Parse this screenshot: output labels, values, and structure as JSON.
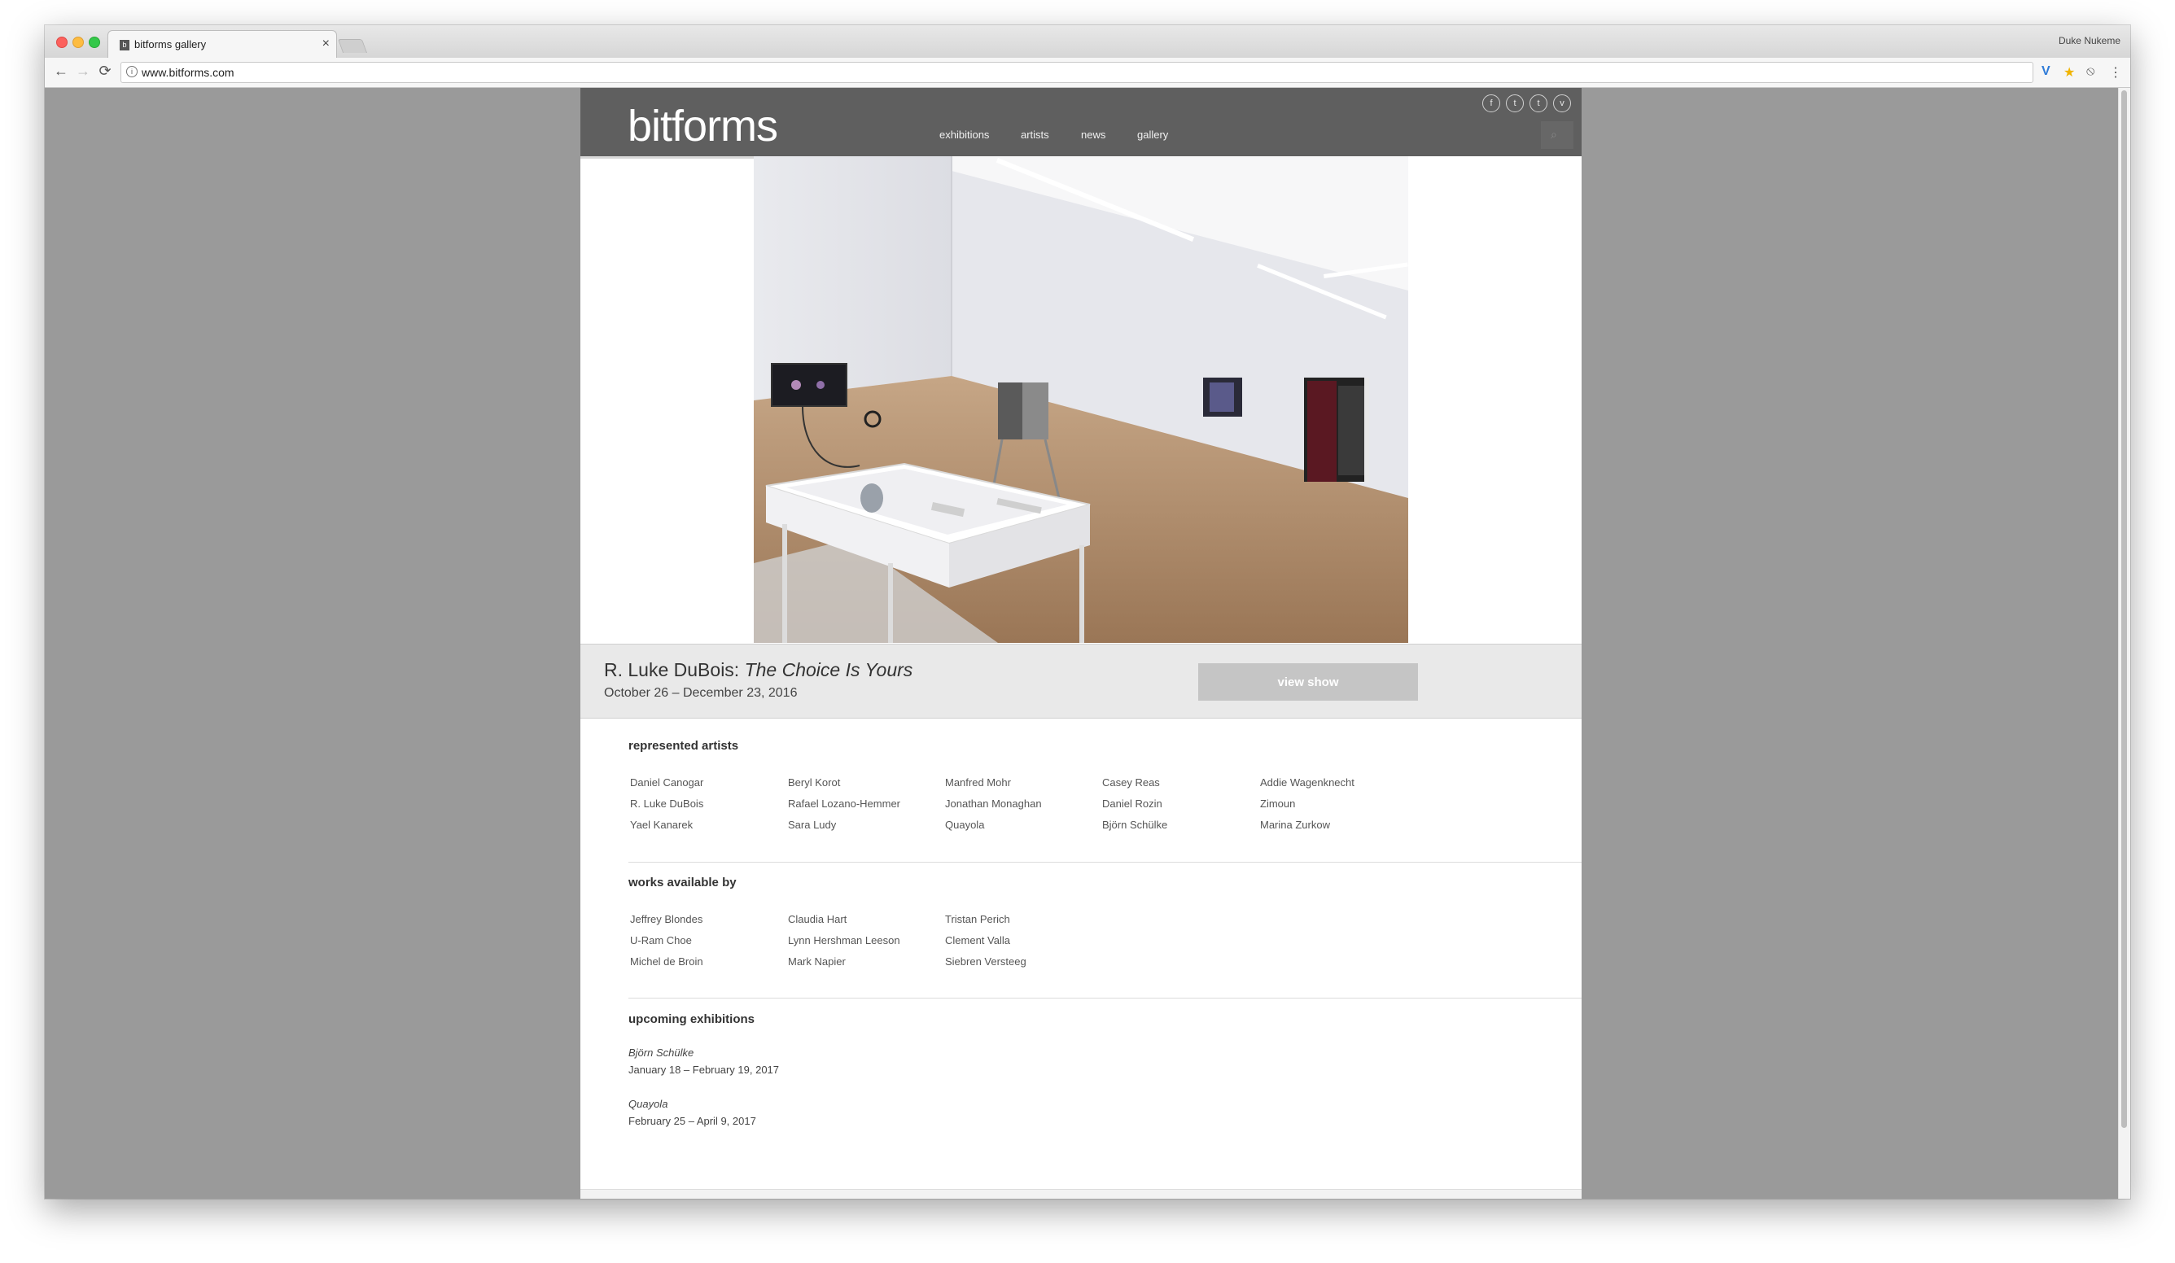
{
  "browser": {
    "tab_title": "bitforms gallery",
    "tab_close": "×",
    "favicon_letter": "b",
    "user_name": "Duke Nukeme",
    "url": "www.bitforms.com",
    "nav": {
      "back": "←",
      "forward": "→",
      "reload": "⟳",
      "info": "i"
    },
    "extensions": [
      "V",
      "★",
      "⦸",
      "⋮"
    ]
  },
  "site": {
    "logo": "bitforms",
    "nav": [
      "exhibitions",
      "artists",
      "news",
      "gallery"
    ],
    "social": [
      "f",
      "t",
      "t",
      "v"
    ],
    "search_glyph": "⌕"
  },
  "featured": {
    "artist": "R. Luke DuBois: ",
    "show_title": "The Choice Is Yours",
    "dates": "October 26 – December 23, 2016",
    "button": "view show"
  },
  "represented": {
    "heading": "represented artists",
    "columns": [
      [
        "Daniel Canogar",
        "R. Luke DuBois",
        "Yael Kanarek"
      ],
      [
        "Beryl Korot",
        "Rafael Lozano-Hemmer",
        "Sara Ludy"
      ],
      [
        "Manfred Mohr",
        "Jonathan Monaghan",
        "Quayola"
      ],
      [
        "Casey Reas",
        "Daniel Rozin",
        "Björn Schülke"
      ],
      [
        "Addie Wagenknecht",
        "Zimoun",
        "Marina Zurkow"
      ]
    ]
  },
  "works": {
    "heading": "works available by",
    "columns": [
      [
        "Jeffrey Blondes",
        "U-Ram Choe",
        "Michel de Broin"
      ],
      [
        "Claudia Hart",
        "Lynn Hershman Leeson",
        "Mark Napier"
      ],
      [
        "Tristan Perich",
        "Clement Valla",
        "Siebren Versteeg"
      ]
    ]
  },
  "upcoming": {
    "heading": "upcoming exhibitions",
    "items": [
      {
        "name": "Björn Schülke",
        "dates": "January 18 – February 19, 2017"
      },
      {
        "name": "Quayola",
        "dates": "February 25 – April 9, 2017"
      }
    ]
  }
}
